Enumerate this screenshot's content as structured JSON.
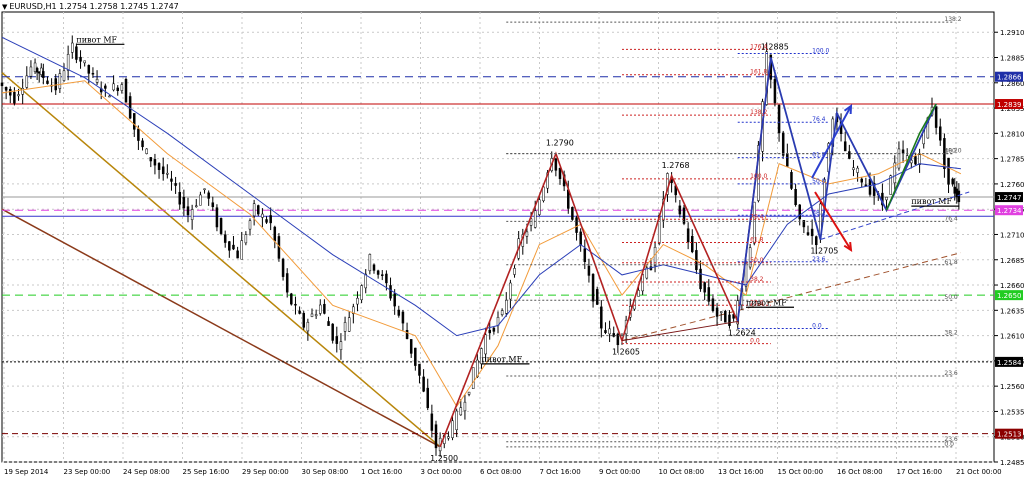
{
  "header": {
    "symbol_line": "EURUSD,H1  1.2754 1.2758 1.2745 1.2747",
    "arrow_icon": "triangle-down-icon"
  },
  "colors": {
    "grid": "#c9c9c9",
    "candle": "#000000",
    "ma_fast": "#f29b3a",
    "ma_slow": "#2b3fb8",
    "red_line": "#c00000",
    "blue_dash": "#1f2fa8",
    "magenta_dash": "#e040e0",
    "green_dash": "#22cc22",
    "brown_trend": "#a0522d",
    "fib_red": "#cc2222",
    "fib_blue": "#2233cc",
    "fib_gray": "#555555"
  },
  "chart_data": {
    "type": "line",
    "title": "EURUSD,H1",
    "ylim": [
      1.2485,
      1.293
    ],
    "y_ticks": [
      "1.2910",
      "1.2885",
      "1.2860",
      "1.2835",
      "1.2810",
      "1.2785",
      "1.2760",
      "1.2735",
      "1.2710",
      "1.2685",
      "1.2660",
      "1.2635",
      "1.2610",
      "1.2585",
      "1.2560",
      "1.2535",
      "1.2510",
      "1.2485"
    ],
    "x_ticks": [
      "19 Sep 2014",
      "23 Sep 00:00",
      "24 Sep 08:00",
      "25 Sep 16:00",
      "29 Sep 00:00",
      "30 Sep 08:00",
      "1 Oct 16:00",
      "3 Oct 00:00",
      "6 Oct 08:00",
      "7 Oct 16:00",
      "9 Oct 00:00",
      "10 Oct 08:00",
      "13 Oct 16:00",
      "15 Oct 00:00",
      "16 Oct 08:00",
      "17 Oct 16:00",
      "21 Oct 00:00"
    ],
    "price_path": [
      [
        0,
        1.286
      ],
      [
        4,
        1.2845
      ],
      [
        8,
        1.2875
      ],
      [
        10,
        1.287
      ],
      [
        14,
        1.2855
      ],
      [
        18,
        1.2895
      ],
      [
        22,
        1.287
      ],
      [
        26,
        1.285
      ],
      [
        30,
        1.286
      ],
      [
        34,
        1.28
      ],
      [
        38,
        1.278
      ],
      [
        42,
        1.276
      ],
      [
        46,
        1.273
      ],
      [
        50,
        1.2755
      ],
      [
        54,
        1.271
      ],
      [
        58,
        1.269
      ],
      [
        62,
        1.2735
      ],
      [
        66,
        1.272
      ],
      [
        70,
        1.265
      ],
      [
        74,
        1.262
      ],
      [
        78,
        1.264
      ],
      [
        82,
        1.26
      ],
      [
        86,
        1.264
      ],
      [
        90,
        1.2685
      ],
      [
        94,
        1.266
      ],
      [
        98,
        1.262
      ],
      [
        102,
        1.257
      ],
      [
        106,
        1.25
      ],
      [
        110,
        1.252
      ],
      [
        114,
        1.256
      ],
      [
        118,
        1.261
      ],
      [
        122,
        1.263
      ],
      [
        126,
        1.27
      ],
      [
        130,
        1.273
      ],
      [
        134,
        1.279
      ],
      [
        138,
        1.274
      ],
      [
        142,
        1.268
      ],
      [
        146,
        1.262
      ],
      [
        150,
        1.2605
      ],
      [
        154,
        1.265
      ],
      [
        158,
        1.268
      ],
      [
        162,
        1.2768
      ],
      [
        166,
        1.272
      ],
      [
        170,
        1.266
      ],
      [
        174,
        1.263
      ],
      [
        178,
        1.2624
      ],
      [
        182,
        1.27
      ],
      [
        186,
        1.2885
      ],
      [
        190,
        1.279
      ],
      [
        194,
        1.272
      ],
      [
        198,
        1.2705
      ],
      [
        202,
        1.283
      ],
      [
        206,
        1.278
      ],
      [
        210,
        1.276
      ],
      [
        214,
        1.274
      ],
      [
        218,
        1.279
      ],
      [
        222,
        1.278
      ],
      [
        226,
        1.2839
      ],
      [
        230,
        1.276
      ],
      [
        232,
        1.2747
      ]
    ],
    "ma_fast": [
      [
        0,
        1.285
      ],
      [
        20,
        1.2862
      ],
      [
        40,
        1.279
      ],
      [
        60,
        1.273
      ],
      [
        80,
        1.264
      ],
      [
        100,
        1.261
      ],
      [
        110,
        1.254
      ],
      [
        120,
        1.26
      ],
      [
        130,
        1.27
      ],
      [
        140,
        1.272
      ],
      [
        150,
        1.265
      ],
      [
        160,
        1.27
      ],
      [
        170,
        1.268
      ],
      [
        180,
        1.265
      ],
      [
        188,
        1.278
      ],
      [
        200,
        1.276
      ],
      [
        212,
        1.277
      ],
      [
        222,
        1.279
      ],
      [
        232,
        1.277
      ]
    ],
    "ma_slow": [
      [
        0,
        1.2905
      ],
      [
        20,
        1.2865
      ],
      [
        40,
        1.281
      ],
      [
        60,
        1.275
      ],
      [
        80,
        1.269
      ],
      [
        100,
        1.264
      ],
      [
        110,
        1.261
      ],
      [
        120,
        1.262
      ],
      [
        130,
        1.267
      ],
      [
        140,
        1.27
      ],
      [
        150,
        1.267
      ],
      [
        160,
        1.268
      ],
      [
        170,
        1.267
      ],
      [
        180,
        1.266
      ],
      [
        190,
        1.272
      ],
      [
        200,
        1.275
      ],
      [
        212,
        1.276
      ],
      [
        222,
        1.278
      ],
      [
        232,
        1.2775
      ]
    ],
    "horizontal_levels": [
      {
        "label": "1.2866",
        "price": 1.2866,
        "style": "blue_dash"
      },
      {
        "label": "1.2839",
        "price": 1.2839,
        "style": "red_line"
      },
      {
        "label": "1.2747",
        "price": 1.2747,
        "style": "current"
      },
      {
        "label": "1.2734",
        "price": 1.2734,
        "style": "magenta_dash"
      },
      {
        "label": "1.2650",
        "price": 1.265,
        "style": "green_dash"
      },
      {
        "label": "1.2584",
        "price": 1.2584,
        "style": "black_dot"
      },
      {
        "label": "1.2513",
        "price": 1.2513,
        "style": "darkred_dash"
      }
    ],
    "swing_labels": [
      {
        "text": "1.2790",
        "x": 134,
        "price": 1.279
      },
      {
        "text": "1.2768",
        "x": 162,
        "price": 1.2768
      },
      {
        "text": "1.2885",
        "x": 186,
        "price": 1.2885
      },
      {
        "text": "1.2705",
        "x": 198,
        "price": 1.2705
      },
      {
        "text": "1.2624",
        "x": 178,
        "price": 1.2624
      },
      {
        "text": "1.2605",
        "x": 150,
        "price": 1.2605
      },
      {
        "text": "1.2500",
        "x": 106,
        "price": 1.25
      }
    ],
    "pivot_labels": [
      {
        "text": "пивот MF",
        "x": 18,
        "price": 1.29
      },
      {
        "text": "пивот MF",
        "x": 116,
        "price": 1.2584
      },
      {
        "text": "пивот MF",
        "x": 180,
        "price": 1.264
      },
      {
        "text": "пивот MF",
        "x": 220,
        "price": 1.274
      }
    ],
    "fib_right": [
      {
        "text": "138.2",
        "price": 1.292
      },
      {
        "text": "100.0",
        "price": 1.279
      },
      {
        "text": "76.4",
        "price": 1.2723
      },
      {
        "text": "61.8",
        "price": 1.268
      },
      {
        "text": "50.0",
        "price": 1.2645
      },
      {
        "text": "38.2",
        "price": 1.261
      },
      {
        "text": "23.6",
        "price": 1.257
      },
      {
        "text": "0.0",
        "price": 1.25
      },
      {
        "text": "38.2",
        "price": 1.279
      },
      {
        "text": "23.6",
        "price": 1.2505
      }
    ],
    "fib_mid_red": [
      {
        "text": "176.4",
        "price": 1.2893
      },
      {
        "text": "161.8",
        "price": 1.2868
      },
      {
        "text": "138.2",
        "price": 1.2828
      },
      {
        "text": "100.0",
        "price": 1.2765
      },
      {
        "text": "76.4",
        "price": 1.2725
      },
      {
        "text": "61.8",
        "price": 1.2702
      },
      {
        "text": "50.0",
        "price": 1.2682
      },
      {
        "text": "38.2",
        "price": 1.2663
      },
      {
        "text": "23.6",
        "price": 1.264
      },
      {
        "text": "0.0",
        "price": 1.2602
      }
    ],
    "fib_mid_blue": [
      {
        "text": "100.0",
        "price": 1.2889
      },
      {
        "text": "76.4",
        "price": 1.2821
      },
      {
        "text": "61.8",
        "price": 1.2786
      },
      {
        "text": "50.0",
        "price": 1.276
      },
      {
        "text": "38.2",
        "price": 1.2729
      },
      {
        "text": "23.6",
        "price": 1.2683
      },
      {
        "text": "0.0",
        "price": 1.2617
      }
    ]
  }
}
